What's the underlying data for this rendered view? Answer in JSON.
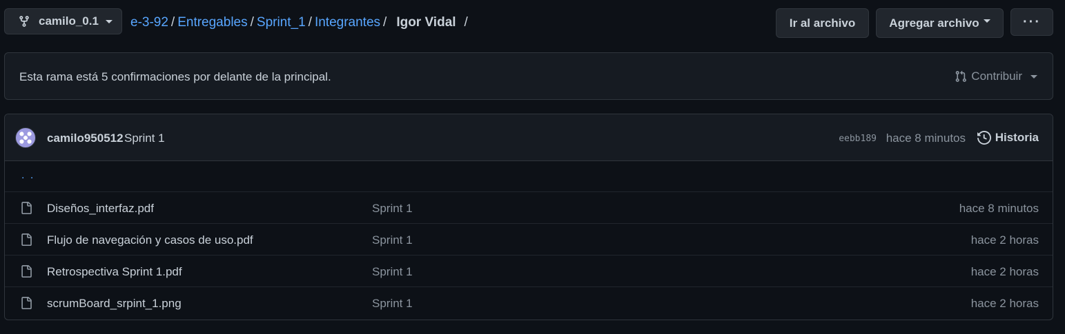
{
  "branch": {
    "label": "camilo_0.1",
    "icon": "git-branch-icon"
  },
  "breadcrumb": {
    "items": [
      "e-3-92",
      "Entregables",
      "Sprint_1",
      "Integrantes"
    ],
    "separator": "/",
    "current": "Igor Vidal",
    "trailing": "/"
  },
  "actions": {
    "goto_file": "Ir al archivo",
    "add_file": "Agregar archivo",
    "more": "···"
  },
  "ahead_banner": {
    "message": "Esta rama está 5 confirmaciones por delante de la principal.",
    "contribute": "Contribuir"
  },
  "latest_commit": {
    "author": "camilo950512",
    "message": "Sprint 1",
    "sha": "eebb189",
    "time": "hace 8 minutos",
    "history": "Historia"
  },
  "files": {
    "parent": ". .",
    "rows": [
      {
        "name": "Diseños_interfaz.pdf",
        "message": "Sprint 1",
        "time": "hace 8 minutos"
      },
      {
        "name": "Flujo de navegación y casos de uso.pdf",
        "message": "Sprint 1",
        "time": "hace 2 horas"
      },
      {
        "name": "Retrospectiva Sprint 1.pdf",
        "message": "Sprint 1",
        "time": "hace 2 horas"
      },
      {
        "name": "scrumBoard_srpint_1.png",
        "message": "Sprint 1",
        "time": "hace 2 horas"
      }
    ]
  },
  "colors": {
    "background": "#0d1117",
    "link": "#58a6ff",
    "muted": "#8b949e",
    "border": "#30363d"
  }
}
